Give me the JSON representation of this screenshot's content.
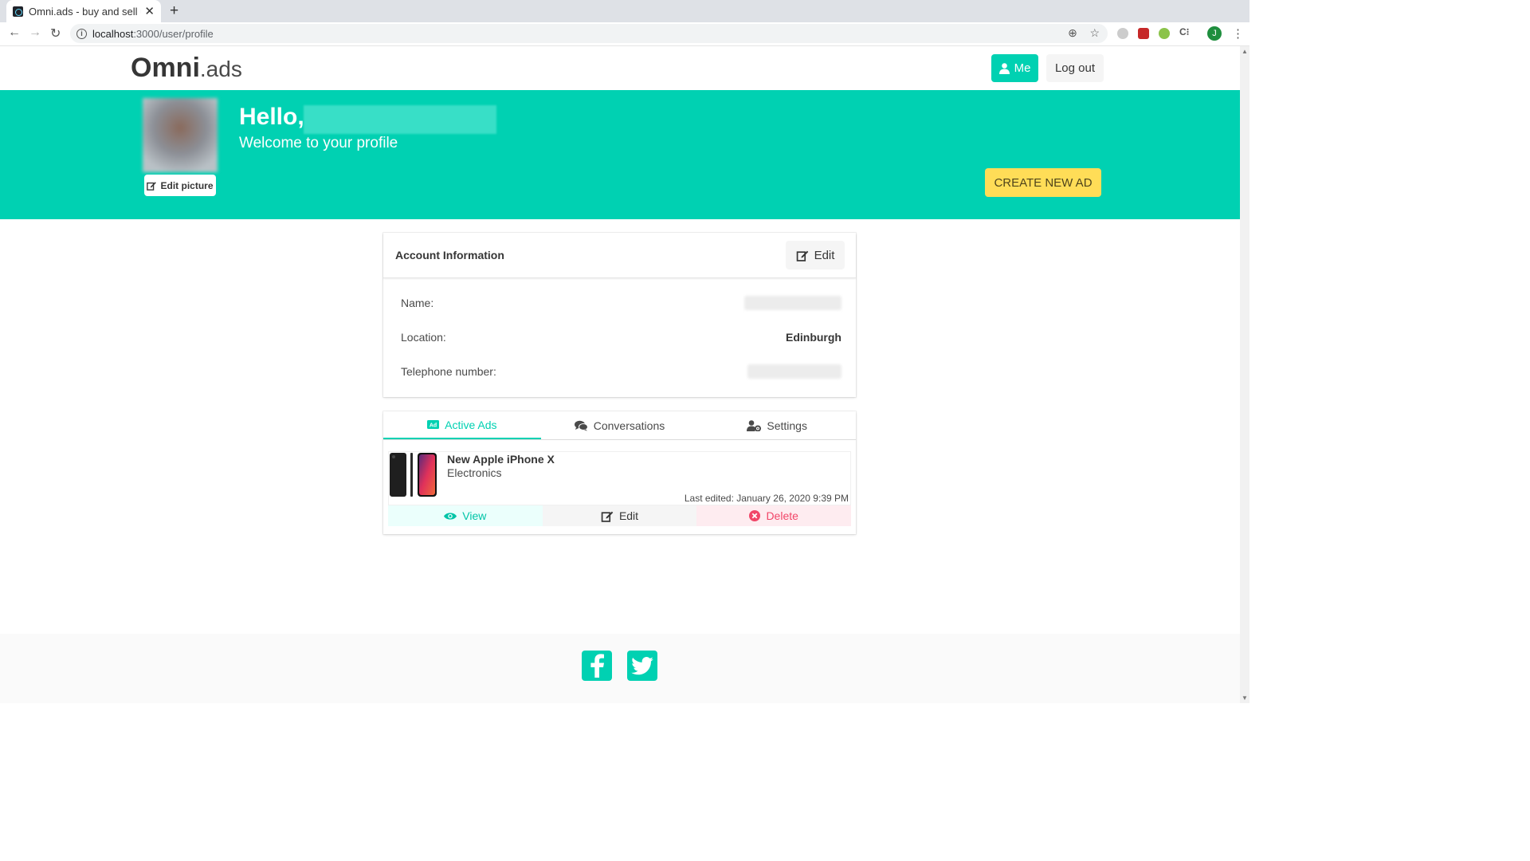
{
  "browser": {
    "tab_title": "Omni.ads - buy and sell u",
    "url_host": "localhost",
    "url_path": ":3000/user/profile",
    "profile_initial": "J"
  },
  "navbar": {
    "logo_bold": "Omni",
    "logo_light": ".ads",
    "me_label": "Me",
    "logout_label": "Log out"
  },
  "hero": {
    "greeting": "Hello,",
    "subtitle": "Welcome to your profile",
    "edit_picture_label": "Edit picture",
    "create_ad_label": "CREATE NEW AD"
  },
  "account": {
    "title": "Account Information",
    "edit_label": "Edit",
    "name_label": "Name:",
    "location_label": "Location:",
    "location_value": "Edinburgh",
    "phone_label": "Telephone number:"
  },
  "tabs": [
    {
      "label": "Active Ads",
      "icon": "ad-icon",
      "active": true
    },
    {
      "label": "Conversations",
      "icon": "comments-icon",
      "active": false
    },
    {
      "label": "Settings",
      "icon": "user-cog-icon",
      "active": false
    }
  ],
  "ads": [
    {
      "title": "New Apple iPhone X",
      "category": "Electronics",
      "last_edited": "Last edited: January 26, 2020 9:39 PM",
      "view_label": "View",
      "edit_label": "Edit",
      "delete_label": "Delete"
    }
  ],
  "colors": {
    "primary": "#00d1b2",
    "warning": "#ffdd57",
    "danger": "#f14668"
  }
}
